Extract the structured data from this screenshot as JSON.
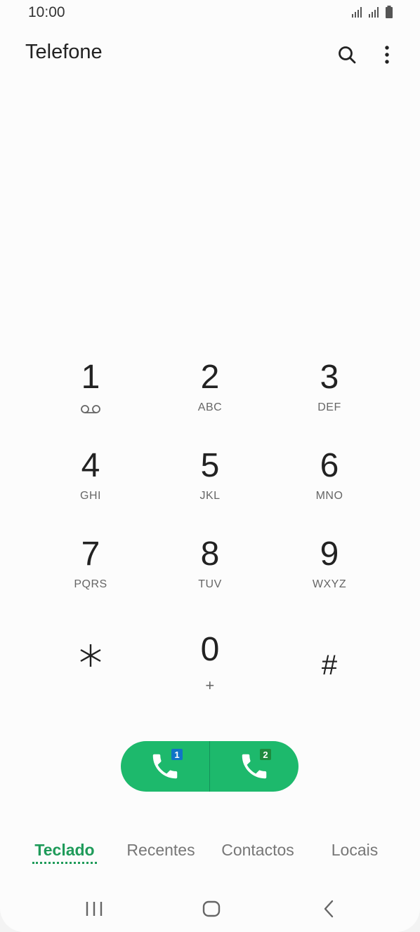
{
  "status": {
    "time": "10:00"
  },
  "header": {
    "title": "Telefone",
    "icons": [
      "search-icon",
      "more-options-icon"
    ]
  },
  "keypad": {
    "keys": [
      {
        "digit": "1",
        "letters": "",
        "icon": "voicemail-icon"
      },
      {
        "digit": "2",
        "letters": "ABC"
      },
      {
        "digit": "3",
        "letters": "DEF"
      },
      {
        "digit": "4",
        "letters": "GHI"
      },
      {
        "digit": "5",
        "letters": "JKL"
      },
      {
        "digit": "6",
        "letters": "MNO"
      },
      {
        "digit": "7",
        "letters": "PQRS"
      },
      {
        "digit": "8",
        "letters": "TUV"
      },
      {
        "digit": "9",
        "letters": "WXYZ"
      },
      {
        "digit": "*",
        "letters": ""
      },
      {
        "digit": "0",
        "letters": "+"
      },
      {
        "digit": "#",
        "letters": ""
      }
    ]
  },
  "call": {
    "sim1_label": "1",
    "sim2_label": "2",
    "color": "#1db96c",
    "sim1_color": "#1174c7",
    "sim2_color": "#1e8a3e"
  },
  "tabs": [
    {
      "label": "Teclado",
      "active": true
    },
    {
      "label": "Recentes",
      "active": false
    },
    {
      "label": "Contactos",
      "active": false
    },
    {
      "label": "Locais",
      "active": false
    }
  ],
  "navbar": {
    "icons": [
      "recent-apps-icon",
      "home-icon",
      "back-icon"
    ]
  },
  "colors": {
    "accent": "#1f9b5a"
  }
}
